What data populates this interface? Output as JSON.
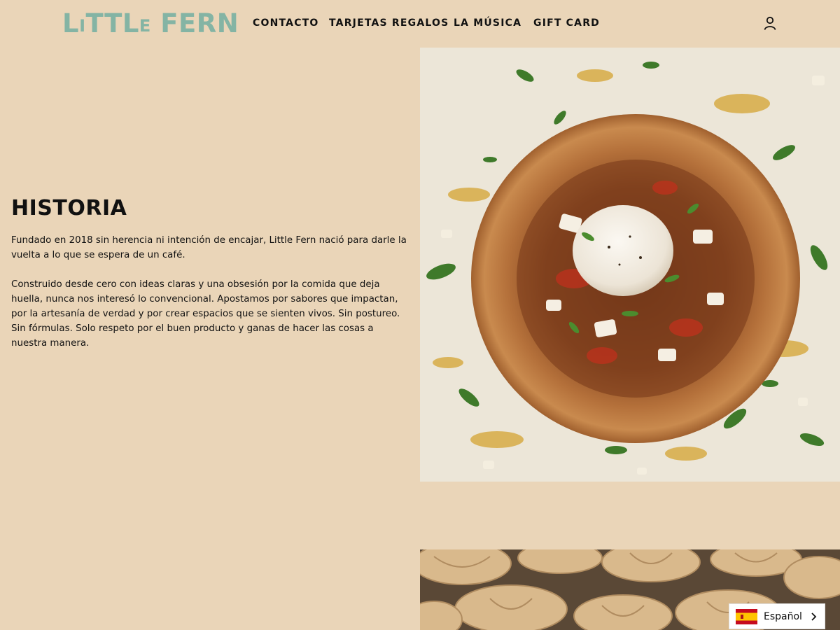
{
  "brand": {
    "logo_text": "LITTLE FERN"
  },
  "nav": {
    "items": [
      {
        "label": "CONTACTO"
      },
      {
        "label": "TARJETAS REGALOS"
      },
      {
        "label": "LA MÚSICA"
      },
      {
        "label": "GIFT CARD"
      }
    ],
    "account_icon": "user-icon"
  },
  "content": {
    "heading": "HISTORIA",
    "paragraph1": "Fundado en 2018 sin herencia ni intención de encajar, Little Fern nació para darle la vuelta a lo que se espera de un café.",
    "paragraph2": "Construido desde cero con ideas claras y una obsesión por la comida que deja huella, nunca nos interesó lo convencional. Apostamos por sabores que impactan, por la artesanía de verdad y por crear espacios que se sienten vivos. Sin postureo. Sin fórmulas. Solo respeto por el buen producto y ganas de hacer las cosas a nuestra manera."
  },
  "language_selector": {
    "label": "Español",
    "flag_icon": "spain-flag-icon",
    "chevron_icon": "chevron-right-icon"
  },
  "colors": {
    "background": "#ead5b8",
    "logo": "#84b4a4",
    "text": "#111111"
  }
}
